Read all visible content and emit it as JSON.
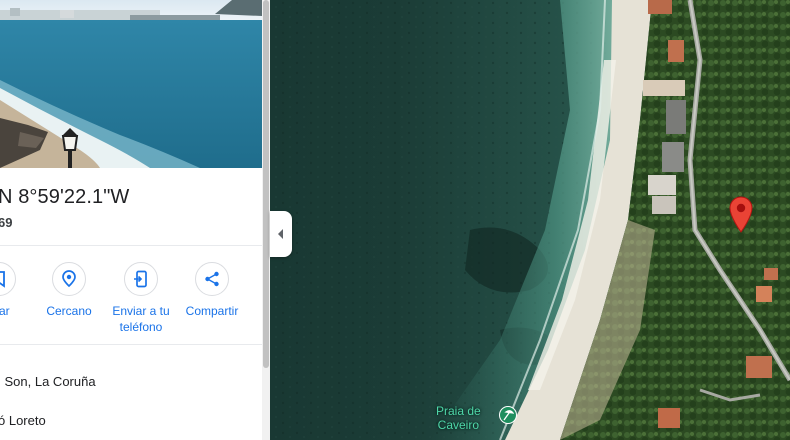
{
  "place": {
    "coords_text": "N 8°59'22.1\"W",
    "plus_code_fragment": "69"
  },
  "actions": [
    {
      "label": "rdar",
      "icon": "bookmark-icon"
    },
    {
      "label": "Cercano",
      "icon": "nearby-icon"
    },
    {
      "label": "Enviar a tu teléfono",
      "icon": "send-to-phone-icon"
    },
    {
      "label": "Compartir",
      "icon": "share-icon"
    }
  ],
  "info": {
    "address_fragment": "l Son, La Coruña",
    "locality_fragment": "ó Loreto"
  },
  "map": {
    "beach_label_line1": "Praia de",
    "beach_label_line2": "Caveiro",
    "beach_icon": "beach-icon",
    "pin_icon": "location-pin-icon"
  },
  "colors": {
    "accent": "#1a73e8",
    "pin": "#ea4335",
    "place_label": "#4fd6a8"
  }
}
